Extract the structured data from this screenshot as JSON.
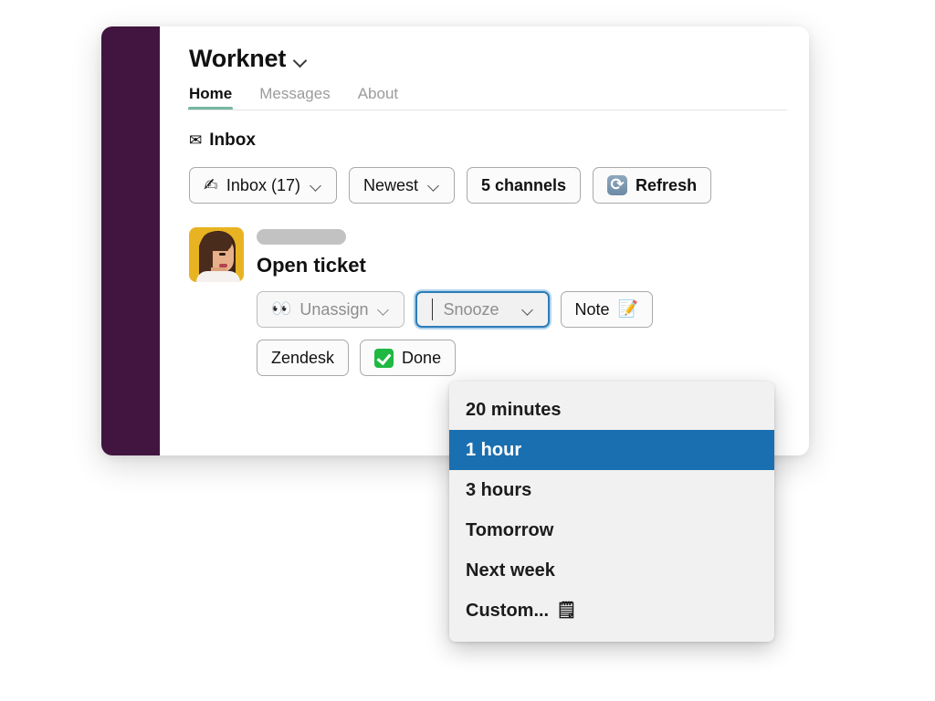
{
  "app": {
    "workspace_title": "Worknet",
    "workspace_caret_icon": "chevron-down-icon",
    "sidebar_color": "#411540",
    "accent_tab_color": "#76b6a3",
    "focus_ring_color": "#2b7cb8",
    "selection_color": "#1a6fb0"
  },
  "tabs": [
    {
      "label": "Home",
      "active": true
    },
    {
      "label": "Messages",
      "active": false
    },
    {
      "label": "About",
      "active": false
    }
  ],
  "inbox_section": {
    "icon": "envelope-icon",
    "icon_glyph": "✉",
    "label": "Inbox"
  },
  "toolbar": [
    {
      "name": "inbox-filter-button",
      "icon": "writing-hand-icon",
      "icon_glyph": "✍",
      "label": "Inbox (17)",
      "caret": true,
      "bold": false
    },
    {
      "name": "sort-button",
      "icon": null,
      "icon_glyph": "",
      "label": "Newest",
      "caret": true,
      "bold": false
    },
    {
      "name": "channels-button",
      "icon": null,
      "icon_glyph": "",
      "label": "5 channels",
      "caret": false,
      "bold": true
    },
    {
      "name": "refresh-button",
      "icon": "refresh-icon",
      "icon_glyph": "",
      "label": "Refresh",
      "caret": false,
      "bold": true
    }
  ],
  "ticket": {
    "avatar_alt": "user-avatar",
    "redacted_name": "",
    "title": "Open ticket",
    "actions_row_one": [
      {
        "name": "unassign-button",
        "icon": "eyes-icon",
        "icon_glyph": "👀",
        "label": "Unassign",
        "caret": true,
        "state": "muted"
      },
      {
        "name": "snooze-button",
        "icon": null,
        "icon_glyph": "",
        "label": "Snooze",
        "caret": true,
        "state": "focused"
      },
      {
        "name": "note-button",
        "icon": "memo-icon",
        "icon_glyph": "📝",
        "label": "Note",
        "caret": false,
        "state": "normal"
      }
    ],
    "actions_row_two": [
      {
        "name": "zendesk-button",
        "icon": null,
        "icon_glyph": "",
        "label": "Zendesk",
        "caret": false,
        "state": "normal"
      },
      {
        "name": "done-button",
        "icon": "green-check-icon",
        "icon_glyph": "",
        "label": "Done",
        "caret": false,
        "state": "normal"
      }
    ]
  },
  "snooze_dropdown": {
    "open": true,
    "items": [
      {
        "label": "20 minutes",
        "selected": false,
        "icon_glyph": ""
      },
      {
        "label": "1 hour",
        "selected": true,
        "icon_glyph": ""
      },
      {
        "label": "3 hours",
        "selected": false,
        "icon_glyph": ""
      },
      {
        "label": "Tomorrow",
        "selected": false,
        "icon_glyph": ""
      },
      {
        "label": "Next week",
        "selected": false,
        "icon_glyph": ""
      },
      {
        "label": "Custom...",
        "selected": false,
        "icon_glyph": "🗒"
      }
    ]
  }
}
